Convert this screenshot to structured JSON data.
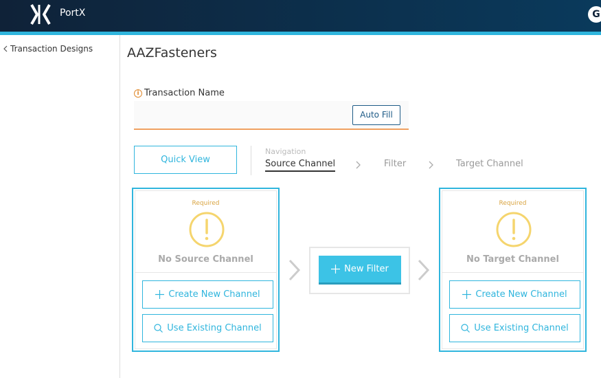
{
  "header": {
    "brand": "PortX",
    "avatar_initial": "G"
  },
  "sidebar": {
    "back_label": "Transaction Designs"
  },
  "page": {
    "title": "AAZFasteners"
  },
  "transaction_name": {
    "label": "Transaction Name",
    "value": "",
    "autofill_label": "Auto Fill"
  },
  "navigation": {
    "quick_view_label": "Quick View",
    "label": "Navigation",
    "steps": [
      "Source Channel",
      "Filter",
      "Target Channel"
    ],
    "active_step": "Source Channel"
  },
  "source_card": {
    "required": "Required",
    "empty_text": "No Source Channel",
    "create_label": "Create New Channel",
    "use_existing_label": "Use Existing Channel"
  },
  "filter": {
    "new_filter_label": "New Filter"
  },
  "target_card": {
    "required": "Required",
    "empty_text": "No Target Channel",
    "create_label": "Create New Channel",
    "use_existing_label": "Use Existing Channel"
  },
  "colors": {
    "accent": "#2fb5dd",
    "header_bg": "#0f2238",
    "warning": "#f5d56e",
    "input_underline": "#f0a060"
  },
  "icons": {
    "logo": "portx-logo-icon",
    "back": "chevron-left-icon",
    "info": "info-icon",
    "warning": "warning-circle-icon",
    "plus": "plus-icon",
    "search": "search-icon",
    "arrow": "chevron-right-icon"
  }
}
